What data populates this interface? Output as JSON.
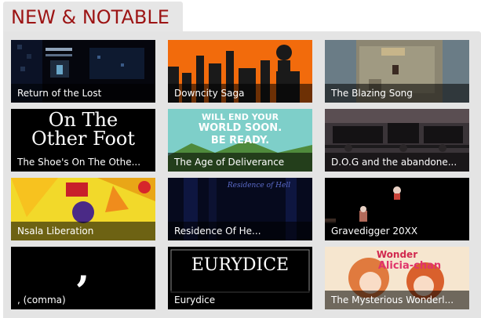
{
  "header": {
    "title": "NEW & NOTABLE"
  },
  "colors": {
    "accent": "#9c1414",
    "panel": "#e4e4e4",
    "tab": "#e6e6e6"
  },
  "games": [
    {
      "title": "Return of the Lost"
    },
    {
      "title": "Downcity Saga"
    },
    {
      "title": "The Blazing Song"
    },
    {
      "title": "The Shoe's On The Othe...",
      "art_text": [
        "On The",
        "Other Foot"
      ]
    },
    {
      "title": "The Age of Deliverance",
      "art_text": [
        "WILL END YOUR",
        "WORLD SOON.",
        "BE READY."
      ]
    },
    {
      "title": "D.O.G and the abandone..."
    },
    {
      "title": "Nsala Liberation"
    },
    {
      "title": "Residence Of He...",
      "art_text": [
        "Residence of Hell"
      ]
    },
    {
      "title": "Gravedigger 20XX"
    },
    {
      "title": ", (comma)",
      "art_text": [
        ","
      ]
    },
    {
      "title": "Eurydice",
      "art_text": [
        "EURYDICE"
      ]
    },
    {
      "title": "The Mysterious Wonderl...",
      "art_text": [
        "Wonder",
        "Alicia-chan"
      ]
    }
  ]
}
